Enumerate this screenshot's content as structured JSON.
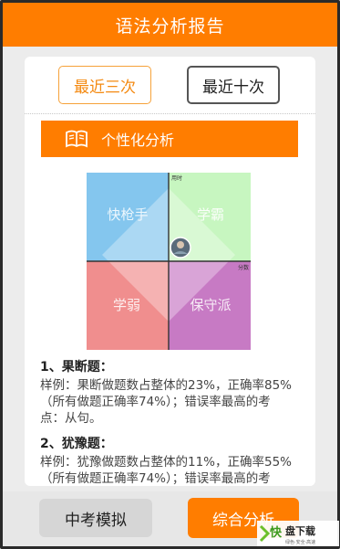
{
  "header": {
    "title": "语法分析报告"
  },
  "tabs": [
    {
      "label": "最近三次",
      "active": true
    },
    {
      "label": "最近十次",
      "active": false
    }
  ],
  "section": {
    "title": "个性化分析",
    "icon": "book-icon"
  },
  "quadrant": {
    "axis_y_label": "用时",
    "axis_x_label": "分数",
    "labels": {
      "top_left": "快枪手",
      "top_right": "学霸",
      "bottom_left": "学弱",
      "bottom_right": "保守派"
    },
    "colors": {
      "top_left": "#84c6ee",
      "top_right": "#c7f6c0",
      "bottom_left": "#f08e8e",
      "bottom_right": "#c77ac4",
      "diamond": "#ffffff"
    }
  },
  "analysis": [
    {
      "heading": "1、果断题：",
      "line1": "样例：果断做题数占整体的23%，正确率85%",
      "line2": "（所有做题正确率74%）；错误率最高的考",
      "line3": "点：从句。"
    },
    {
      "heading": "2、犹豫题：",
      "line1": "样例：犹豫做题数占整体的11%，正确率55%",
      "line2": "（所有做题正确率74%）；错误率最高的考"
    }
  ],
  "footer": {
    "mock_label": "中考模拟",
    "analysis_label": "综合分析"
  },
  "watermark": {
    "brand": "快盘下载",
    "tagline": "绿色·安全·高速"
  },
  "colors": {
    "accent": "#ff7d00",
    "background": "#ececec"
  }
}
